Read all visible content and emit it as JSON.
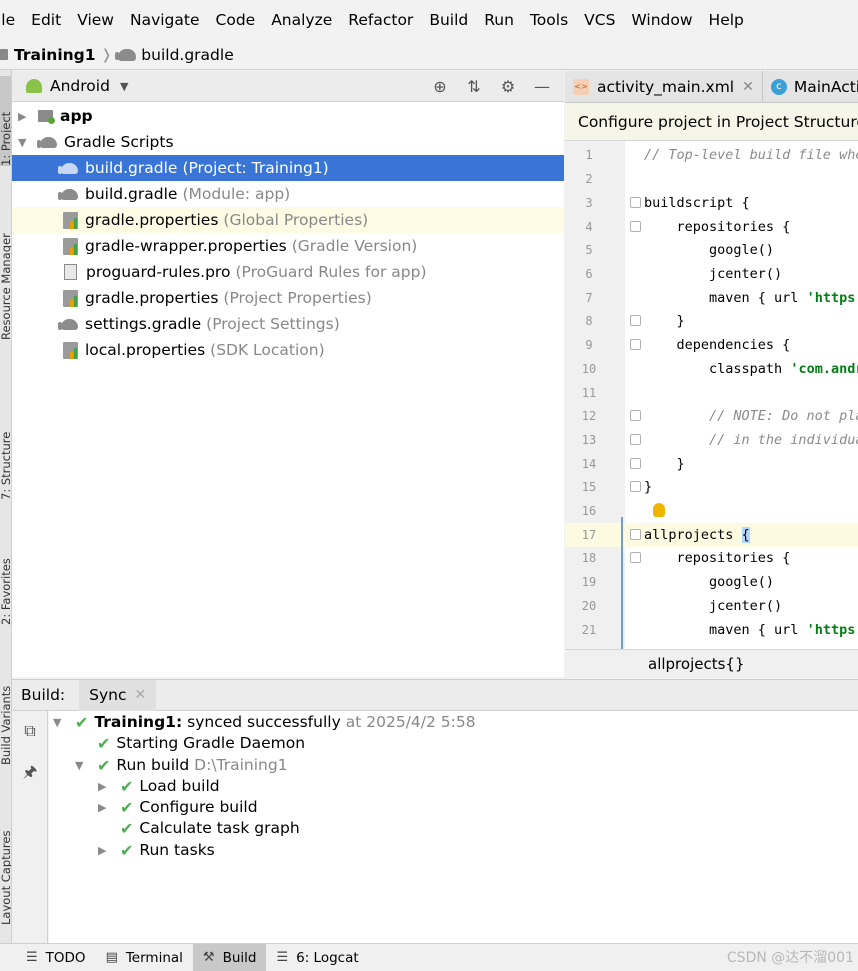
{
  "menu": [
    "ile",
    "Edit",
    "View",
    "Navigate",
    "Code",
    "Analyze",
    "Refactor",
    "Build",
    "Run",
    "Tools",
    "VCS",
    "Window",
    "Help"
  ],
  "breadcrumb": {
    "project": "Training1",
    "file": "build.gradle"
  },
  "left_tool_tabs": [
    "1: Project",
    "Resource Manager",
    "7: Structure",
    "2: Favorites",
    "Build Variants",
    "Layout Captures"
  ],
  "project_panel": {
    "view": "Android"
  },
  "tree": [
    {
      "label": "app",
      "sub": ""
    },
    {
      "label": "Gradle Scripts",
      "sub": ""
    },
    {
      "label": "build.gradle",
      "sub": "(Project: Training1)"
    },
    {
      "label": "build.gradle",
      "sub": "(Module: app)"
    },
    {
      "label": "gradle.properties",
      "sub": "(Global Properties)"
    },
    {
      "label": "gradle-wrapper.properties",
      "sub": "(Gradle Version)"
    },
    {
      "label": "proguard-rules.pro",
      "sub": "(ProGuard Rules for app)"
    },
    {
      "label": "gradle.properties",
      "sub": "(Project Properties)"
    },
    {
      "label": "settings.gradle",
      "sub": "(Project Settings)"
    },
    {
      "label": "local.properties",
      "sub": "(SDK Location)"
    }
  ],
  "editor_tabs": [
    "activity_main.xml",
    "MainActiv"
  ],
  "notification": "Configure project in Project Structure d",
  "code": {
    "line_numbers": [
      "1",
      "2",
      "3",
      "4",
      "5",
      "6",
      "7",
      "8",
      "9",
      "10",
      "11",
      "12",
      "13",
      "14",
      "15",
      "16",
      "17",
      "18",
      "19",
      "20",
      "21"
    ],
    "lines": [
      "// Top-level build file whe",
      "",
      "buildscript {",
      "    repositories {",
      "        google()",
      "        jcenter()",
      "        maven { url ",
      "    }",
      "    dependencies {",
      "        classpath ",
      "",
      "        // NOTE: Do not pla",
      "        // in the individua",
      "    }",
      "}",
      "",
      "allprojects ",
      "    repositories {",
      "        google()",
      "        jcenter()",
      "        maven { url "
    ],
    "strings": {
      "l7": "'https:",
      "l10": "'com.andr",
      "l21": "'https:"
    },
    "brace": "{"
  },
  "editor_breadcrumb": "allprojects{}",
  "build_panel": {
    "label": "Build:",
    "tab": "Sync",
    "root": {
      "name": "Training1:",
      "status": "synced successfully",
      "time": "at 2025/4/2 5:58"
    },
    "items": [
      {
        "label": "Starting Gradle Daemon",
        "extra": ""
      },
      {
        "label": "Run build",
        "extra": "D:\\Training1"
      },
      {
        "label": "Load build",
        "extra": ""
      },
      {
        "label": "Configure build",
        "extra": ""
      },
      {
        "label": "Calculate task graph",
        "extra": ""
      },
      {
        "label": "Run tasks",
        "extra": ""
      }
    ]
  },
  "bottom_tabs": [
    "TODO",
    "Terminal",
    "Build",
    "6: Logcat"
  ],
  "watermark": "CSDN @达不溜001",
  "colors": {
    "selection": "#3875d7",
    "check": "#4caf50",
    "string": "#067d17"
  }
}
